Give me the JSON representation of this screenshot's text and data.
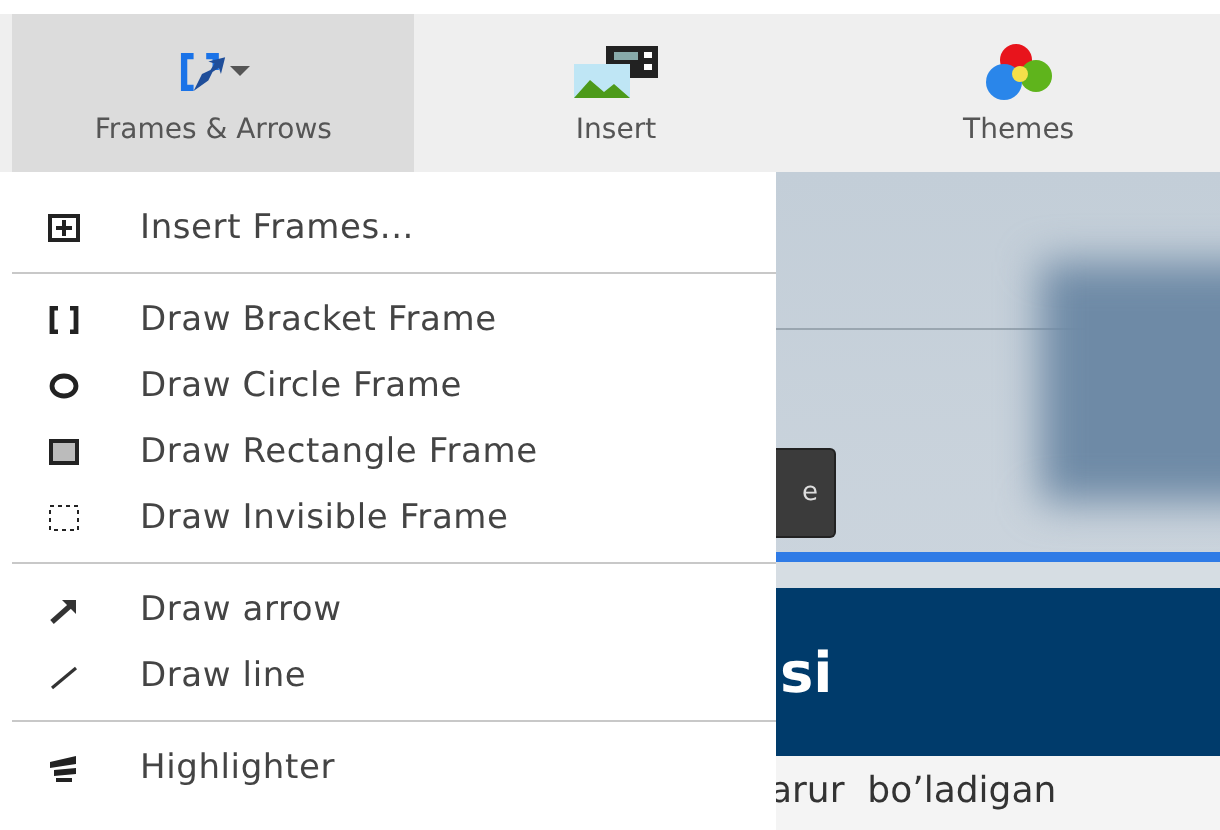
{
  "toolbar": {
    "tabs": [
      {
        "label": "Frames & Arrows",
        "kind": "frames",
        "selected": true,
        "dropdown": true
      },
      {
        "label": "Insert",
        "kind": "insert",
        "selected": false,
        "dropdown": false
      },
      {
        "label": "Themes",
        "kind": "themes",
        "selected": false,
        "dropdown": false
      }
    ]
  },
  "menu": {
    "sections": [
      [
        {
          "label": "Insert Frames...",
          "kind": "insert-frame"
        }
      ],
      [
        {
          "label": "Draw Bracket Frame",
          "kind": "bracket"
        },
        {
          "label": "Draw Circle Frame",
          "kind": "circle"
        },
        {
          "label": "Draw Rectangle Frame",
          "kind": "rectangle"
        },
        {
          "label": "Draw Invisible Frame",
          "kind": "invisible"
        }
      ],
      [
        {
          "label": "Draw arrow",
          "kind": "arrow"
        },
        {
          "label": "Draw line",
          "kind": "line"
        }
      ],
      [
        {
          "label": "Highlighter",
          "kind": "highlighter"
        }
      ]
    ]
  },
  "slide": {
    "button_label": "e",
    "heading": "si",
    "body": "arur  bo’ladigan"
  }
}
